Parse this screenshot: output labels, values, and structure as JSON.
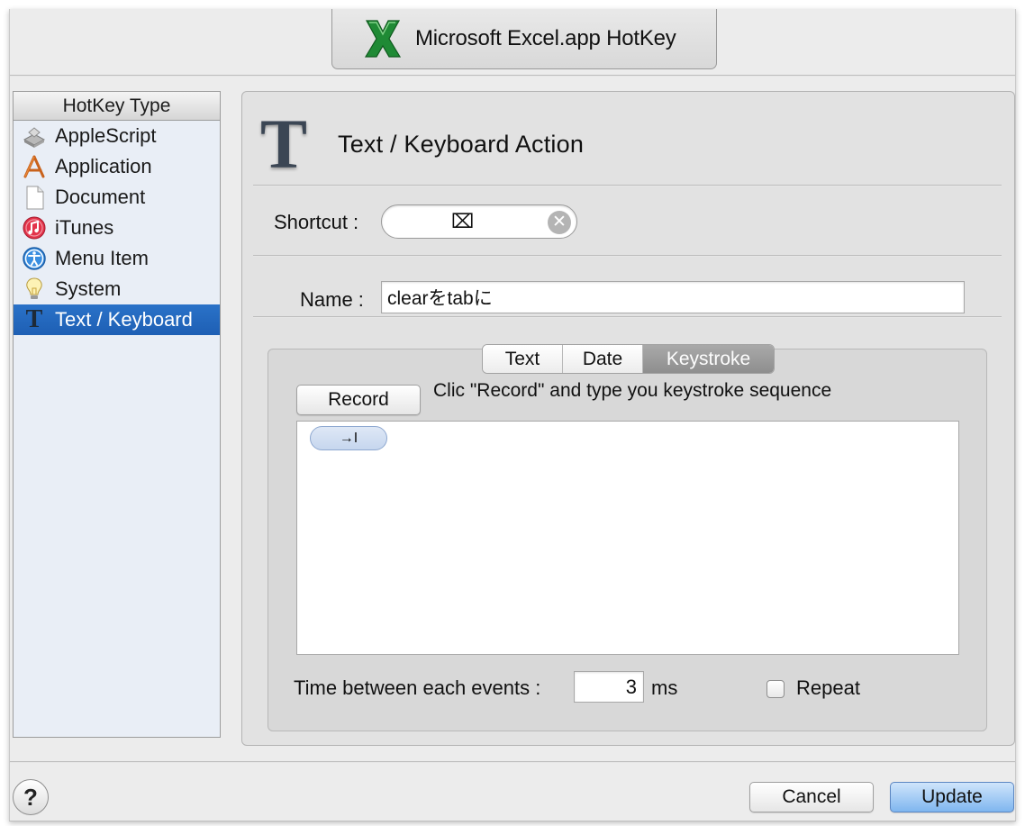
{
  "app_header": {
    "title": "Microsoft Excel.app HotKey",
    "icon": "excel-x-icon"
  },
  "sidebar": {
    "header": "HotKey Type",
    "items": [
      {
        "label": "AppleScript",
        "icon": "applescript-icon"
      },
      {
        "label": "Application",
        "icon": "application-icon"
      },
      {
        "label": "Document",
        "icon": "document-icon"
      },
      {
        "label": "iTunes",
        "icon": "itunes-icon"
      },
      {
        "label": "Menu Item",
        "icon": "menu-item-icon"
      },
      {
        "label": "System",
        "icon": "system-icon"
      },
      {
        "label": "Text / Keyboard",
        "icon": "text-keyboard-icon",
        "selected": true
      }
    ]
  },
  "action": {
    "icon_letter": "T",
    "title": "Text / Keyboard Action"
  },
  "shortcut": {
    "label": "Shortcut :",
    "value": "⌧",
    "clear_icon": "✕"
  },
  "name": {
    "label": "Name :",
    "value": "clearをtabに"
  },
  "tabs": [
    {
      "label": "Text"
    },
    {
      "label": "Date"
    },
    {
      "label": "Keystroke",
      "active": true
    }
  ],
  "keystroke": {
    "record_label": "Record",
    "hint": "Clic \"Record\" and type you keystroke sequence",
    "tokens": [
      "→I"
    ]
  },
  "timing": {
    "label": "Time between each events :",
    "value": "3",
    "unit": "ms"
  },
  "repeat": {
    "label": "Repeat",
    "checked": false
  },
  "footer": {
    "help": "?",
    "cancel": "Cancel",
    "update": "Update"
  },
  "colors": {
    "selection": "#1e5fb4",
    "default_button": "#7fb6ef",
    "excel_green": "#1f8a35"
  }
}
